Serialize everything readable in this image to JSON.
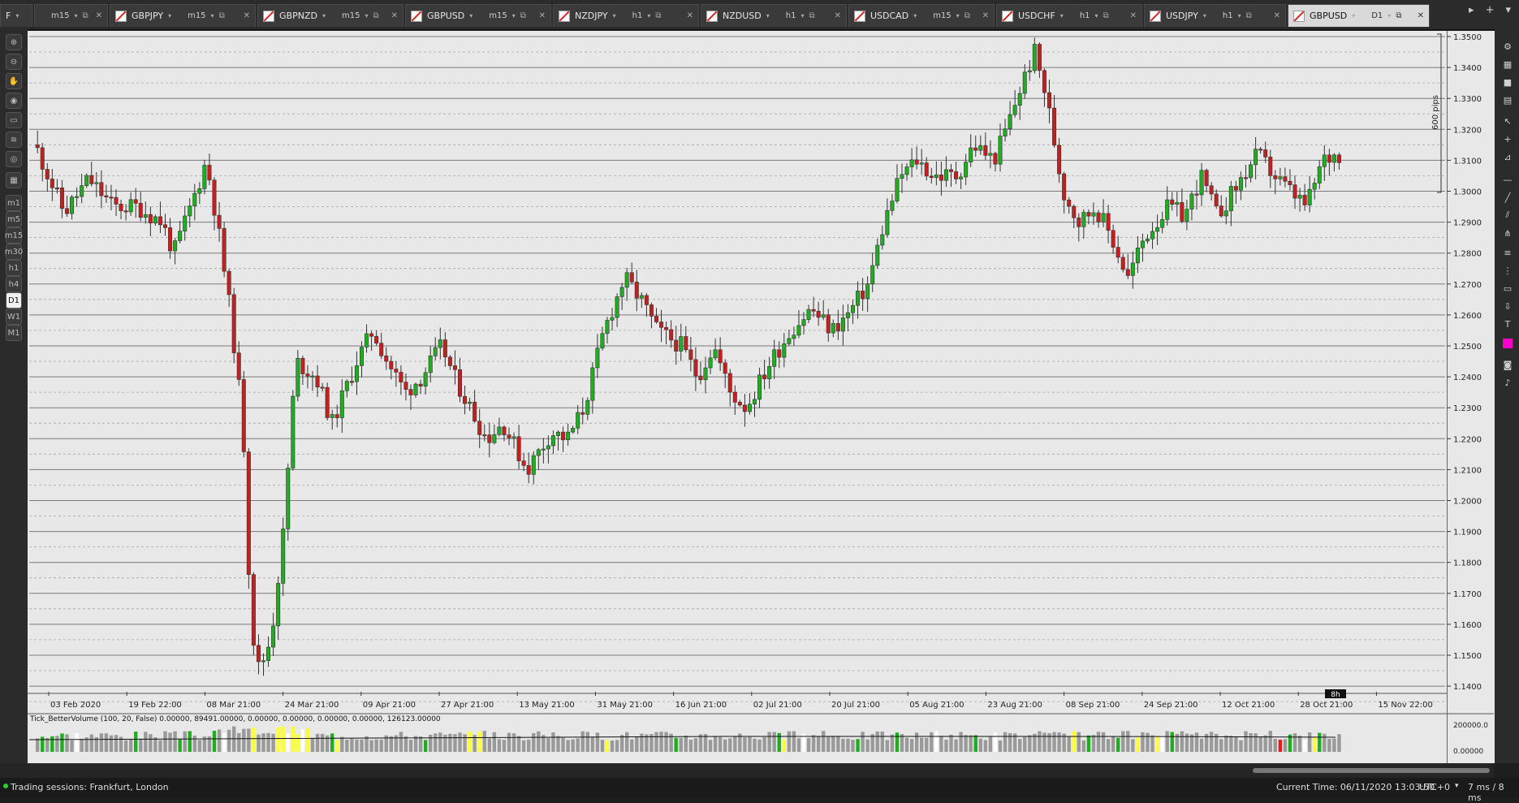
{
  "tabs": [
    {
      "symbol": "F",
      "timeframe": "",
      "active": false
    },
    {
      "symbol": "",
      "timeframe": "m15",
      "active": false
    },
    {
      "symbol": "GBPJPY",
      "timeframe": "m15",
      "active": false
    },
    {
      "symbol": "GBPNZD",
      "timeframe": "m15",
      "active": false
    },
    {
      "symbol": "GBPUSD",
      "timeframe": "m15",
      "active": false
    },
    {
      "symbol": "NZDJPY",
      "timeframe": "h1",
      "active": false
    },
    {
      "symbol": "NZDUSD",
      "timeframe": "h1",
      "active": false
    },
    {
      "symbol": "USDCAD",
      "timeframe": "m15",
      "active": false
    },
    {
      "symbol": "USDCHF",
      "timeframe": "h1",
      "active": false
    },
    {
      "symbol": "USDJPY",
      "timeframe": "h1",
      "active": false
    },
    {
      "symbol": "GBPUSD",
      "timeframe": "D1",
      "active": true
    }
  ],
  "tab_nav": {
    "prev": "▸",
    "add": "+",
    "menu": "▾"
  },
  "left_toolbar": [
    {
      "icon": "zoom-in-icon",
      "glyph": "⊕"
    },
    {
      "icon": "zoom-out-icon",
      "glyph": "⊖"
    },
    {
      "icon": "hand-icon",
      "glyph": "✋"
    },
    {
      "icon": "bookmark-icon",
      "glyph": "◉"
    },
    {
      "icon": "object-manager-icon",
      "glyph": "▭"
    },
    {
      "icon": "layers-icon",
      "glyph": "≋"
    },
    {
      "icon": "eye-icon",
      "glyph": "◎"
    },
    {
      "icon": "template-icon",
      "glyph": "▦"
    },
    {
      "icon": "timeframe-m1",
      "glyph": "m1"
    },
    {
      "icon": "timeframe-m5",
      "glyph": "m5"
    },
    {
      "icon": "timeframe-m15",
      "glyph": "m15"
    },
    {
      "icon": "timeframe-m30",
      "glyph": "m30"
    },
    {
      "icon": "timeframe-h1",
      "glyph": "h1"
    },
    {
      "icon": "timeframe-h4",
      "glyph": "h4"
    },
    {
      "icon": "timeframe-d1",
      "glyph": "D1",
      "active": true
    },
    {
      "icon": "timeframe-w1",
      "glyph": "W1"
    },
    {
      "icon": "timeframe-mn1",
      "glyph": "M1"
    }
  ],
  "right_toolbar": [
    {
      "icon": "settings-icon",
      "glyph": "⚙"
    },
    {
      "icon": "grid-layout-icon",
      "glyph": "▦"
    },
    {
      "icon": "single-chart-icon",
      "glyph": "■"
    },
    {
      "icon": "split-chart-icon",
      "glyph": "▤"
    },
    {
      "icon": "cursor-icon",
      "glyph": "↖"
    },
    {
      "icon": "crosshair-icon",
      "glyph": "+"
    },
    {
      "icon": "measure-icon",
      "glyph": "⊿"
    },
    {
      "icon": "horizontal-line-icon",
      "glyph": "—"
    },
    {
      "icon": "trend-line-icon",
      "glyph": "╱"
    },
    {
      "icon": "channel-icon",
      "glyph": "⫽"
    },
    {
      "icon": "pitchfork-icon",
      "glyph": "⋔"
    },
    {
      "icon": "fibonacci-icon",
      "glyph": "≡"
    },
    {
      "icon": "fib-extension-icon",
      "glyph": "⋮"
    },
    {
      "icon": "rectangle-icon",
      "glyph": "▭"
    },
    {
      "icon": "arrow-icon",
      "glyph": "⇩"
    },
    {
      "icon": "text-icon",
      "glyph": "T"
    },
    {
      "icon": "color-swatch-icon",
      "glyph": "",
      "color": "#ff00cc"
    },
    {
      "icon": "camera-icon",
      "glyph": "◙"
    },
    {
      "icon": "alert-bell-icon",
      "glyph": "♪"
    }
  ],
  "chart": {
    "bull_color": "#1fae1f",
    "bear_color": "#c81e1e",
    "background": "#e8e8e8",
    "range_label": "600 pips",
    "countdown": "8h",
    "indicator_label": "Tick_BetterVolume (100, 20, False) 0.00000, 89491.00000, 0.00000, 0.00000, 0.00000, 0.00000, 126123.00000",
    "volume_ticks": [
      "200000.0",
      "0.00000"
    ]
  },
  "chart_data": {
    "type": "candlestick",
    "title": "",
    "y_ticks": [
      "1.3500",
      "1.3400",
      "1.3300",
      "1.3200",
      "1.3100",
      "1.3000",
      "1.2900",
      "1.2800",
      "1.2700",
      "1.2600",
      "1.2500",
      "1.2400",
      "1.2300",
      "1.2200",
      "1.2100",
      "1.2000",
      "1.1900",
      "1.1800",
      "1.1700",
      "1.1600",
      "1.1500",
      "1.1400"
    ],
    "ylim": [
      1.3963,
      1.4947
    ],
    "y_axis_values": [
      1.35,
      1.34,
      1.33,
      1.32,
      1.31,
      1.3,
      1.29,
      1.28,
      1.27,
      1.26,
      1.25,
      1.24,
      1.23,
      1.22,
      1.21,
      1.2,
      1.19,
      1.18,
      1.17,
      1.16,
      1.15,
      1.14
    ],
    "x_ticks": [
      "03 Feb 2020",
      "19 Feb 22:00",
      "08 Mar 21:00",
      "24 Mar 21:00",
      "09 Apr 21:00",
      "27 Apr 21:00",
      "13 May 21:00",
      "31 May 21:00",
      "16 Jun 21:00",
      "02 Jul 21:00",
      "20 Jul 21:00",
      "05 Aug 21:00",
      "23 Aug 21:00",
      "08 Sep 21:00",
      "24 Sep 21:00",
      "12 Oct 21:00",
      "28 Oct 21:00",
      "15 Nov 22:00"
    ],
    "key_points": [
      {
        "date": "03 Feb 2020",
        "price": 1.3
      },
      {
        "date": "08 Mar 21:00",
        "price": 1.31
      },
      {
        "date": "19 Mar 2020",
        "price": 1.145
      },
      {
        "date": "09 Apr 21:00",
        "price": 1.25
      },
      {
        "date": "13 May 21:00",
        "price": 1.21
      },
      {
        "date": "31 May 21:00",
        "price": 1.275
      },
      {
        "date": "16 Jun 21:00",
        "price": 1.235
      },
      {
        "date": "20 Jul 21:00",
        "price": 1.275
      },
      {
        "date": "05 Aug 21:00",
        "price": 1.31
      },
      {
        "date": "01 Sep 2020",
        "price": 1.345
      },
      {
        "date": "08 Sep 21:00",
        "price": 1.285
      },
      {
        "date": "24 Sep 21:00",
        "price": 1.275
      },
      {
        "date": "12 Oct 21:00",
        "price": 1.3
      },
      {
        "date": "06 Nov 2020",
        "price": 1.315
      }
    ]
  },
  "status": {
    "sessions": "Trading sessions: Frankfurt, London",
    "current_time": "Current Time:  06/11/2020 13:03:50",
    "timezone": "UTC+0",
    "latency": "7 ms / 8 ms"
  }
}
